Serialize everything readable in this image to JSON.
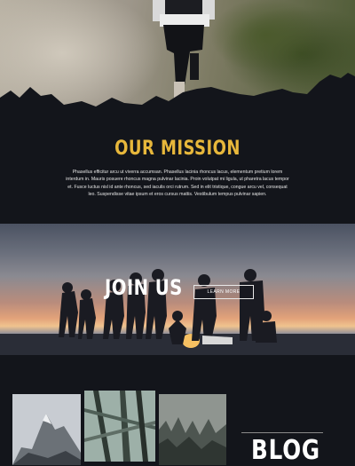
{
  "mission": {
    "title": "OUR MISSION",
    "body": "Phasellus efficitur arcu ut viverra accumsan. Phasellus lacinia rhoncus lacus, elementum pretium lorem interdum in. Mauris posuere rhoncus magna pulvinar lacinia. Proin volutpat mi ligula, ut pharetra lacus tempor et. Fusce luctus nisl id ante rhoncus, sed iaculis orci rutrum. Sed in elit tristique, congue arcu vel, consequat leo. Suspendisse vitae ipsum et eros cursus mattis. Vestibulum tempus pulvinar sapien."
  },
  "join": {
    "title": "JOIN US",
    "button_label": "LEARN MORE"
  },
  "blog": {
    "title": "BLOG",
    "thumbnails": [
      "mountain-peak",
      "forest-branches",
      "misty-forest"
    ]
  },
  "colors": {
    "background": "#13151b",
    "accent": "#e7b73b",
    "text": "#e6e6e6"
  }
}
